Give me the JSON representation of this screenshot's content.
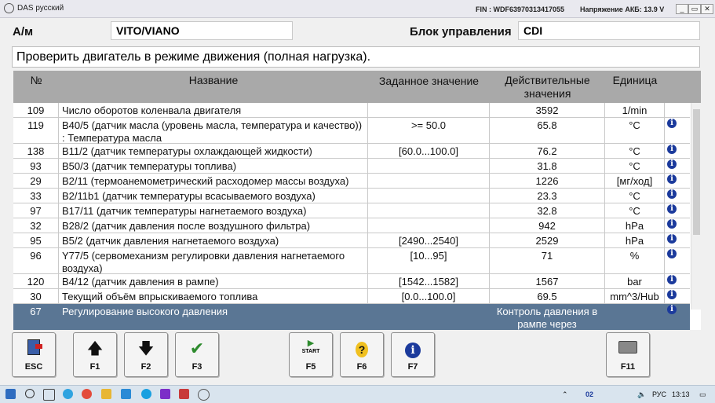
{
  "titlebar": {
    "app_title": "DAS русский",
    "fin": "FIN : WDF63970313417055",
    "voltage": "Напряжение АКБ: 13.9 V"
  },
  "header": {
    "vehicle_label": "А/м",
    "vehicle_value": "VITO/VIANO",
    "ecu_label": "Блок управления",
    "ecu_value": "CDI"
  },
  "message": "Проверить двигатель в режиме движения (полная нагрузка).",
  "table": {
    "headers": {
      "num": "№",
      "name": "Название",
      "set": "Заданное значение",
      "act": "Действительные значения",
      "unit": "Единица"
    },
    "rows": [
      {
        "num": "109",
        "name": "Число оборотов коленвала двигателя",
        "set": "",
        "act": "3592",
        "unit": "1/min",
        "info": false
      },
      {
        "num": "119",
        "name": "B40/5 (датчик масла (уровень масла, температура и качество)) : Температура масла",
        "set": ">= 50.0",
        "act": "65.8",
        "unit": "°C",
        "info": true
      },
      {
        "num": "138",
        "name": "B11/2 (датчик температуры охлаждающей жидкости)",
        "set": "[60.0...100.0]",
        "act": "76.2",
        "unit": "°C",
        "info": true
      },
      {
        "num": "93",
        "name": "B50/3 (датчик температуры топлива)",
        "set": "",
        "act": "31.8",
        "unit": "°C",
        "info": true
      },
      {
        "num": "29",
        "name": "B2/11 (термоанемометрический расходомер массы воздуха)",
        "set": "",
        "act": "1226",
        "unit": "[мг/ход]",
        "info": true
      },
      {
        "num": "33",
        "name": "B2/11b1 (датчик температуры всасываемого воздуха)",
        "set": "",
        "act": "23.3",
        "unit": "°C",
        "info": true
      },
      {
        "num": "97",
        "name": "B17/11 (датчик температуры нагнетаемого воздуха)",
        "set": "",
        "act": "32.8",
        "unit": "°C",
        "info": true
      },
      {
        "num": "32",
        "name": "B28/2 (датчик давления после воздушного фильтра)",
        "set": "",
        "act": "942",
        "unit": "hPa",
        "info": true
      },
      {
        "num": "95",
        "name": "B5/2 (датчик давления нагнетаемого воздуха)",
        "set": "[2490...2540]",
        "act": "2529",
        "unit": "hPa",
        "info": true
      },
      {
        "num": "96",
        "name": "Y77/5 (сервомеханизм регулировки давления нагнетаемого воздуха)",
        "set": "[10...95]",
        "act": "71",
        "unit": "%",
        "info": true
      },
      {
        "num": "120",
        "name": "B4/12 (датчик давления в рампе)",
        "set": "[1542...1582]",
        "act": "1567",
        "unit": "bar",
        "info": true
      },
      {
        "num": "30",
        "name": "Текущий объём впрыскиваемого топлива",
        "set": "[0.0...100.0]",
        "act": "69.5",
        "unit": "mm^3/Hub",
        "info": true
      },
      {
        "num": "67",
        "name": "Регулирование высокого давления",
        "set": "",
        "act": "Контроль давления в рампе через",
        "unit": "",
        "info": true,
        "selected": true
      }
    ]
  },
  "buttons": [
    {
      "id": "esc",
      "label": "ESC",
      "icon": "door-exit-icon"
    },
    {
      "id": "f1",
      "label": "F1",
      "icon": "arrow-up-icon"
    },
    {
      "id": "f2",
      "label": "F2",
      "icon": "arrow-down-icon"
    },
    {
      "id": "f3",
      "label": "F3",
      "icon": "checkmark-icon"
    },
    {
      "id": "f5",
      "label": "F5",
      "icon": "start-icon",
      "icon_text": "START"
    },
    {
      "id": "f6",
      "label": "F6",
      "icon": "help-icon"
    },
    {
      "id": "f7",
      "label": "F7",
      "icon": "info-icon"
    },
    {
      "id": "f11",
      "label": "F11",
      "icon": "printer-icon"
    }
  ],
  "taskbar": {
    "language": "РУС",
    "time": "13:13",
    "badge": "02"
  },
  "colors": {
    "header_bg": "#a9a9a9",
    "selected_row": "#5a7694",
    "info_icon": "#1b3a9c",
    "check_green": "#2e8b2e"
  }
}
